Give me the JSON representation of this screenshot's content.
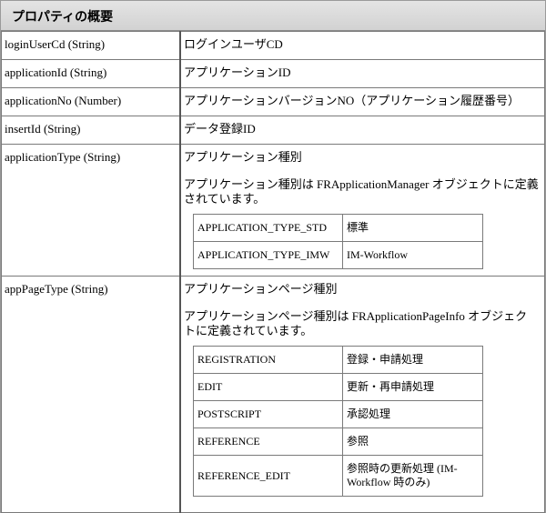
{
  "title": "プロパティの概要",
  "rows": [
    {
      "name": "loginUserCd (String)",
      "value": "ログインユーザCD"
    },
    {
      "name": "applicationId (String)",
      "value": "アプリケーションID"
    },
    {
      "name": "applicationNo (Number)",
      "value": "アプリケーションバージョンNO（アプリケーション履歴番号）"
    },
    {
      "name": "insertId (String)",
      "value": "データ登録ID"
    },
    {
      "name": "applicationType (String)",
      "value": "アプリケーション種別",
      "desc": "アプリケーション種別は FRApplicationManager オブジェクトに定義されています。",
      "table": [
        {
          "key": "APPLICATION_TYPE_STD",
          "val": "標準"
        },
        {
          "key": "APPLICATION_TYPE_IMW",
          "val": "IM-Workflow"
        }
      ]
    },
    {
      "name": "appPageType (String)",
      "value": "アプリケーションページ種別",
      "desc": "アプリケーションページ種別は FRApplicationPageInfo オブジェクトに定義されています。",
      "table": [
        {
          "key": "REGISTRATION",
          "val": "登録・申請処理"
        },
        {
          "key": "EDIT",
          "val": "更新・再申請処理"
        },
        {
          "key": "POSTSCRIPT",
          "val": "承認処理"
        },
        {
          "key": "REFERENCE",
          "val": "参照"
        },
        {
          "key": "REFERENCE_EDIT",
          "val": "参照時の更新処理 (IM-Workflow 時のみ)"
        }
      ]
    }
  ]
}
